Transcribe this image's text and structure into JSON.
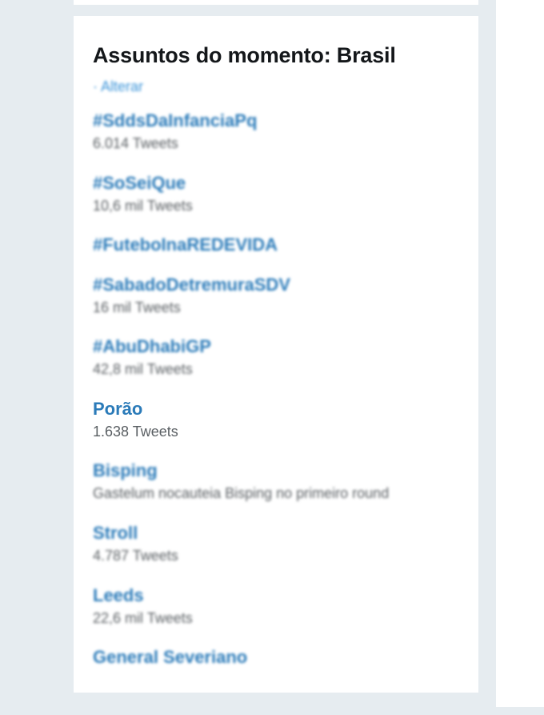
{
  "trends_card": {
    "title": "Assuntos do momento: Brasil",
    "change_label": "· Alterar",
    "items": [
      {
        "name": "#SddsDaInfanciaPq",
        "meta": "6.014 Tweets"
      },
      {
        "name": "#SoSeiQue",
        "meta": "10,6 mil Tweets"
      },
      {
        "name": "#FuteboInaREDEVIDA",
        "meta": ""
      },
      {
        "name": "#SabadoDetremuraSDV",
        "meta": "16 mil Tweets"
      },
      {
        "name": "#AbuDhabiGP",
        "meta": "42,8 mil Tweets"
      },
      {
        "name": "Porão",
        "meta": "1.638 Tweets"
      },
      {
        "name": "Bisping",
        "meta": "Gastelum nocauteia Bisping no primeiro round"
      },
      {
        "name": "Stroll",
        "meta": "4.787 Tweets"
      },
      {
        "name": "Leeds",
        "meta": "22,6 mil Tweets"
      },
      {
        "name": "General Severiano",
        "meta": ""
      }
    ]
  },
  "colors": {
    "page_background": "#e6ecf0",
    "card_background": "#ffffff",
    "trend_link": "#2b7bb9",
    "meta_text": "#5a5f63",
    "title_text": "#14171a"
  }
}
